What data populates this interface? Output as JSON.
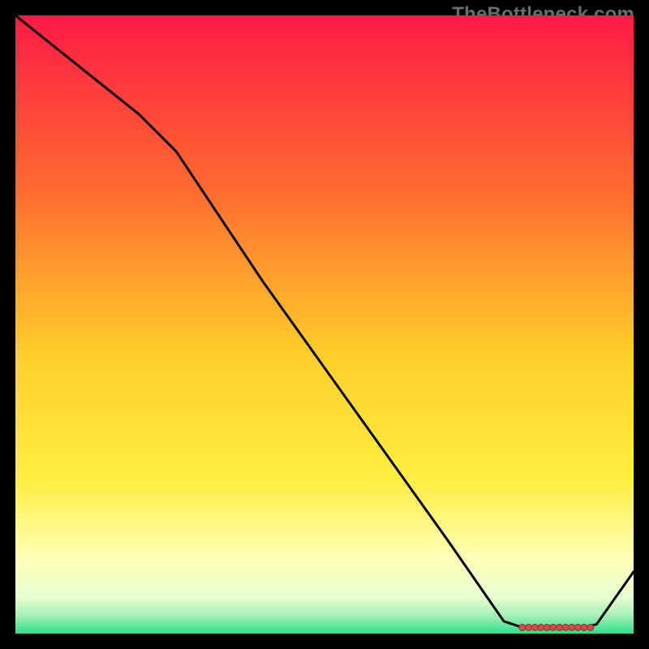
{
  "watermark": "TheBottleneck.com",
  "colors": {
    "bg": "#000000",
    "grad_top": "#ff1a46",
    "grad_mid1": "#ff8a2a",
    "grad_mid2": "#ffe92a",
    "grad_yellow_pale": "#ffffb0",
    "grad_green": "#2be08a",
    "line": "#000000",
    "marker_fill": "#d34a4a",
    "marker_stroke": "#9a2a2a"
  },
  "chart_data": {
    "type": "line",
    "title": "",
    "xlabel": "",
    "ylabel": "",
    "xlim": [
      0,
      100
    ],
    "ylim": [
      0,
      100
    ],
    "series": [
      {
        "name": "curve",
        "x": [
          0,
          10,
          20,
          26,
          40,
          55,
          70,
          79,
          82,
          84,
          86,
          88,
          90,
          92,
          94,
          100
        ],
        "y": [
          100,
          92,
          84,
          78,
          57,
          36,
          15,
          2,
          1,
          1,
          1,
          1,
          1,
          1,
          1.5,
          10
        ]
      }
    ],
    "markers": {
      "name": "optimal-range",
      "x": [
        82,
        83,
        84,
        85,
        86,
        87,
        88,
        89,
        90,
        91,
        92,
        93
      ],
      "y": [
        1,
        1,
        1,
        1,
        1,
        1,
        1,
        1,
        1,
        1,
        1,
        1
      ]
    }
  }
}
